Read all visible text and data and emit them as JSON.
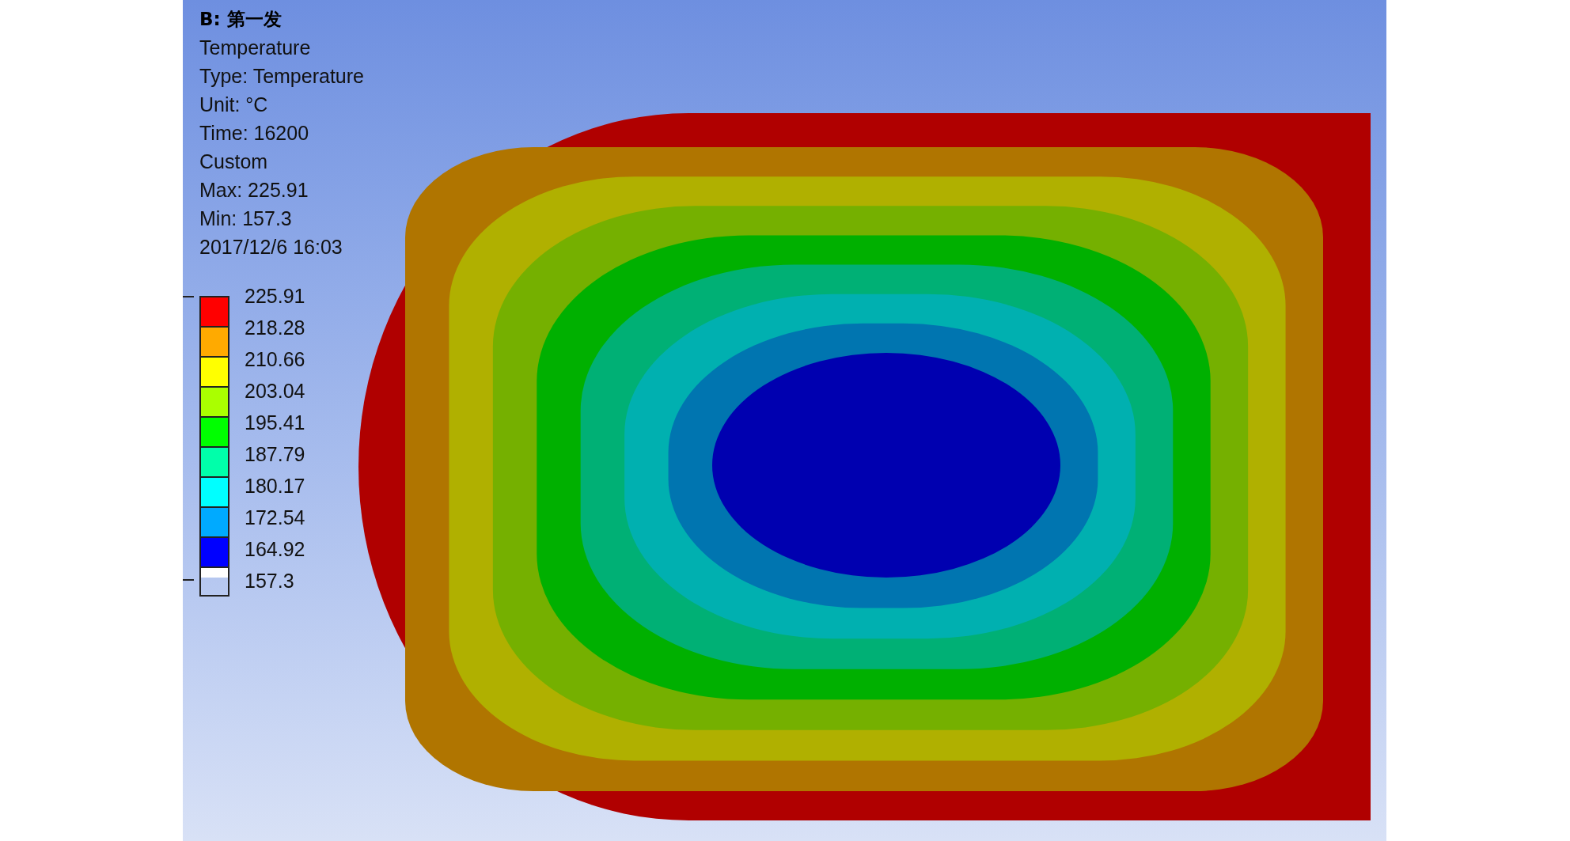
{
  "header": {
    "title": "B: 第一发",
    "lines": [
      "Temperature",
      "Type: Temperature",
      "Unit: °C",
      "Time: 16200",
      "Custom",
      "Max: 225.91",
      "Min: 157.3",
      "2017/12/6 16:03"
    ]
  },
  "legend": {
    "labels": [
      "225.91",
      "218.28",
      "210.66",
      "203.04",
      "195.41",
      "187.79",
      "180.17",
      "172.54",
      "164.92",
      "157.3"
    ],
    "bands": [
      {
        "color": "#ff0000"
      },
      {
        "color": "#ffaa00"
      },
      {
        "color": "#ffff00"
      },
      {
        "color": "#aaff00"
      },
      {
        "color": "#00ff00"
      },
      {
        "color": "#00ffaa"
      },
      {
        "color": "#00ffff"
      },
      {
        "color": "#00aaff"
      },
      {
        "color": "#0000ff"
      },
      {
        "color": "#ffffff"
      }
    ]
  }
}
